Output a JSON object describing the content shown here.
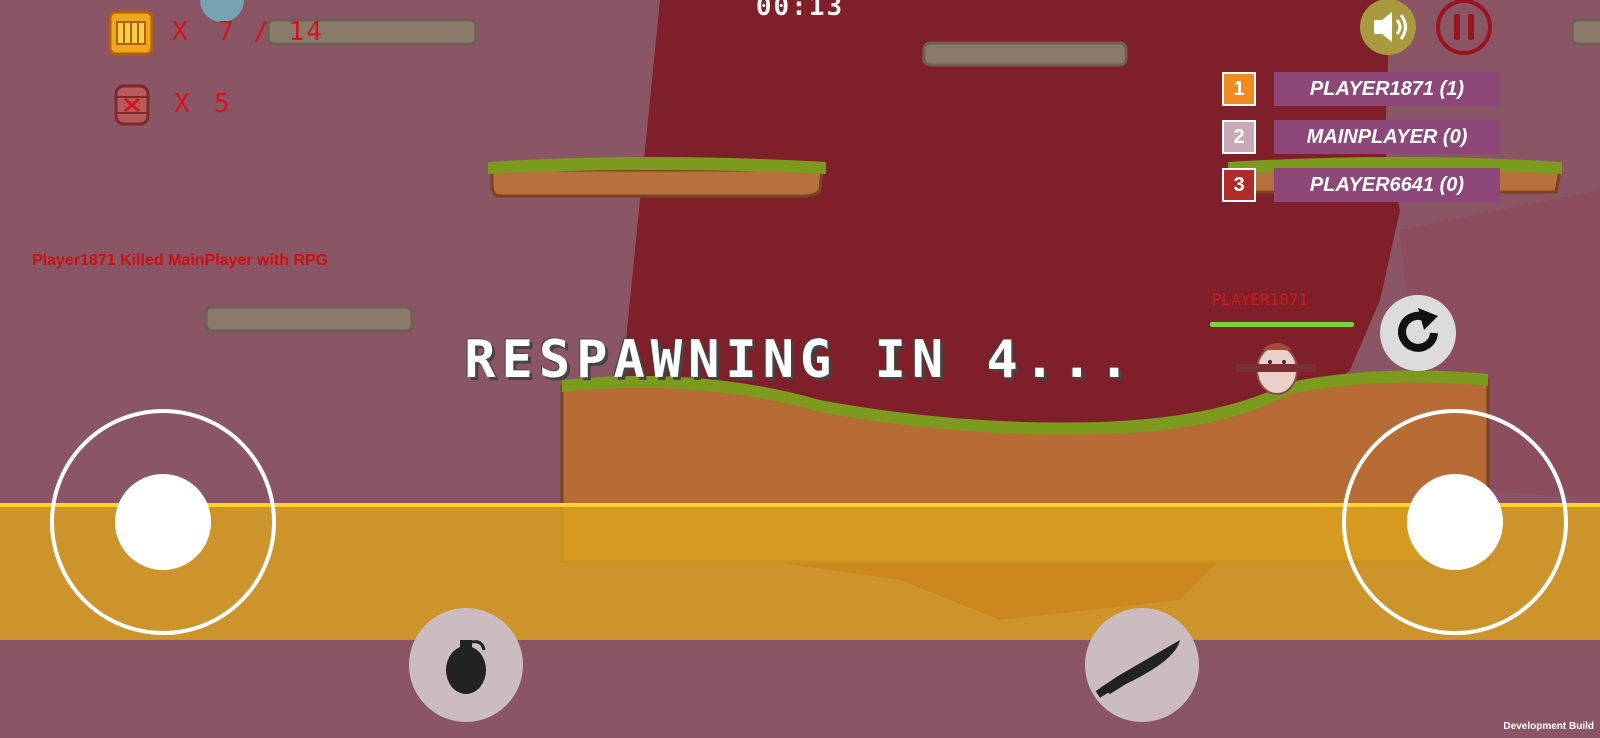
{
  "hud": {
    "timer": "00:13",
    "ammo": {
      "icon": "ammo-crate-icon",
      "x": "X",
      "value": "7 / 14"
    },
    "grenades": {
      "icon": "grenade-barrel-icon",
      "x": "X",
      "value": "5"
    },
    "killfeed": "Player1871 Killed MainPlayer with RPG",
    "respawn": "RESPAWNING IN 4...",
    "build": "Development Build"
  },
  "buttons": {
    "sound": {
      "icon": "speaker-icon"
    },
    "pause": {
      "icon": "pause-icon"
    },
    "reload": {
      "icon": "reload-icon"
    },
    "grenade": {
      "icon": "grenade-icon"
    },
    "knife": {
      "icon": "knife-icon"
    }
  },
  "leaderboard": [
    {
      "rank": "1",
      "name": "PLAYER1871 (1)",
      "color": "#f08a1e"
    },
    {
      "rank": "2",
      "name": "MAINPLAYER (0)",
      "color": "#c9a9b3"
    },
    {
      "rank": "3",
      "name": "PLAYER6641 (0)",
      "color": "#b02a2a"
    }
  ],
  "player": {
    "name": "PLAYER1871",
    "health": 1.0
  },
  "colors": {
    "background": "#8a5564",
    "cave": "#7e1f29",
    "dirt": "#b86c35",
    "grass": "#7b9a1e",
    "lava": "#e0a61c",
    "accent_red": "#d4141c"
  }
}
